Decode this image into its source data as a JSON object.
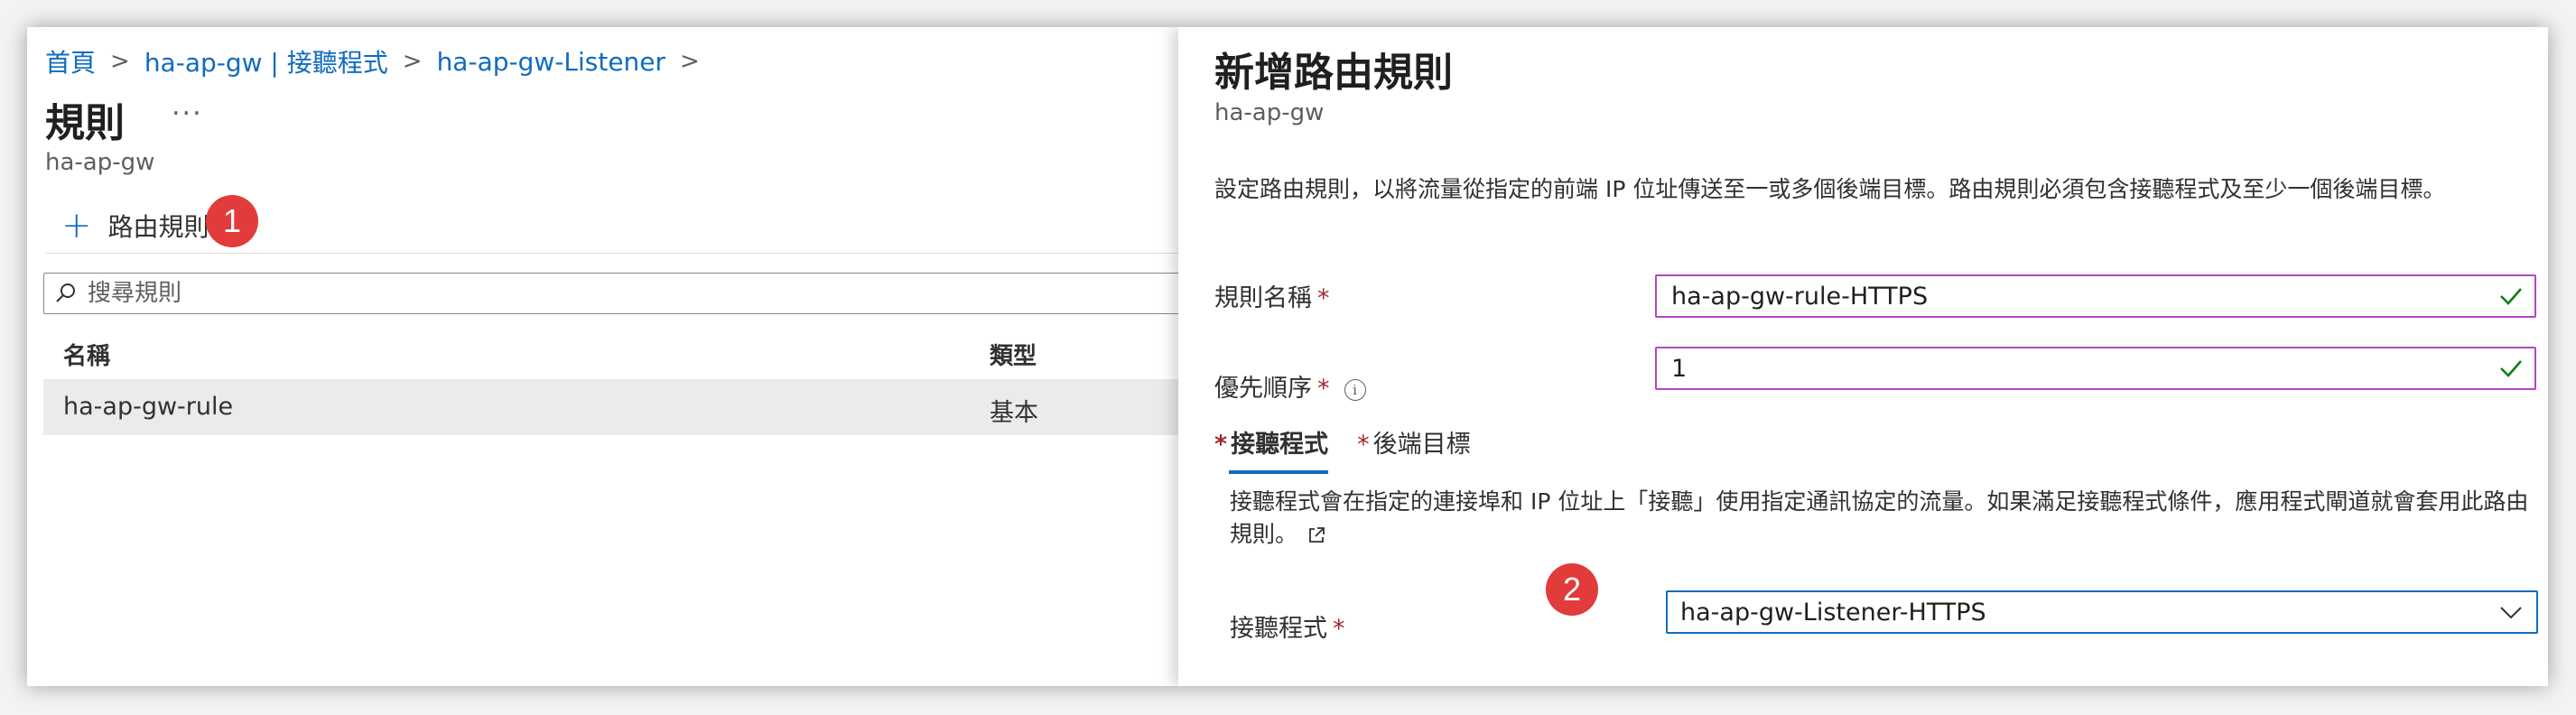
{
  "breadcrumb": {
    "items": [
      "首頁",
      "ha-ap-gw | 接聽程式",
      "ha-ap-gw-Listener"
    ],
    "separator": ">"
  },
  "page": {
    "title": "規則",
    "more": "...",
    "subtitle": "ha-ap-gw"
  },
  "toolbar": {
    "add_rule_label": "路由規則",
    "add_icon": "plus-icon"
  },
  "search": {
    "placeholder": "搜尋規則",
    "value": ""
  },
  "table": {
    "columns": [
      "名稱",
      "類型"
    ],
    "rows": [
      {
        "name": "ha-ap-gw-rule",
        "type": "基本"
      }
    ]
  },
  "annotations": {
    "badge1": "1",
    "badge2": "2",
    "badge_color": "#e23b3b"
  },
  "panel": {
    "title": "新增路由規則",
    "subtitle": "ha-ap-gw",
    "description": "設定路由規則，以將流量從指定的前端 IP 位址傳送至一或多個後端目標。路由規則必須包含接聽程式及至少一個後端目標。",
    "rule_name": {
      "label": "規則名稱",
      "required_mark": "*",
      "value": "ha-ap-gw-rule-HTTPS",
      "valid": true
    },
    "priority": {
      "label": "優先順序",
      "required_mark": "*",
      "value": "1",
      "valid": true,
      "info_icon": "i"
    },
    "tabs": [
      {
        "label": "接聽程式",
        "required_mark": "*",
        "active": true
      },
      {
        "label": "後端目標",
        "required_mark": "*",
        "active": false
      }
    ],
    "listener_description": "接聽程式會在指定的連接埠和 IP 位址上「接聽」使用指定通訊協定的流量。如果滿足接聽程式條件，應用程式閘道就會套用此路由規則。",
    "listener": {
      "label": "接聽程式",
      "required_mark": "*",
      "value": "ha-ap-gw-Listener-HTTPS"
    }
  },
  "colors": {
    "link": "#0f6cbd",
    "required": "#a4262c",
    "input_border": "#b146c2",
    "valid_check": "#107c10",
    "selected_row": "#edebe9"
  }
}
